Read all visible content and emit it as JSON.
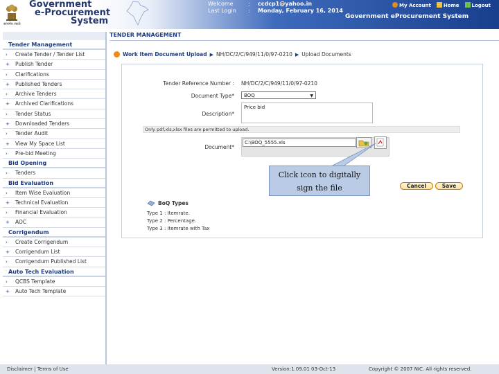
{
  "header": {
    "brand": [
      "Government",
      "e-Procurement",
      "System"
    ],
    "emblem_caption": "सत्यमेव जयते",
    "welcome_label": "Welcome",
    "welcome_value": "ccdcp1@yahoo.in",
    "lastlogin_label": "Last Login",
    "lastlogin_value": "Monday, February 16, 2014",
    "colon": ":",
    "links": {
      "account": "My Account",
      "home": "Home",
      "logout": "Logout"
    },
    "system_title": "Government eProcurement System"
  },
  "sidebar": {
    "sections": [
      {
        "title": "Tender Management",
        "items": [
          "Create Tender / Tender List",
          "Publish Tender",
          "Clarifications",
          "Published Tenders",
          "Archive Tenders",
          "Archived Clarifications",
          "Tender Status",
          "Downloaded Tenders",
          "Tender Audit",
          "View My Space List",
          "Pre-bid Meeting"
        ]
      },
      {
        "title": "Bid Opening",
        "items": [
          "Tenders"
        ]
      },
      {
        "title": "Bid Evaluation",
        "items": [
          "Item Wise Evaluation",
          "Technical Evaluation",
          "Financial Evaluation",
          "AOC"
        ]
      },
      {
        "title": "Corrigendum",
        "items": [
          "Create Corrigendum",
          "Corrigendum List",
          "Corrigendum Published List"
        ]
      },
      {
        "title": "Auto Tech Evaluation",
        "items": [
          "QCBS Template",
          "Auto Tech Template"
        ]
      }
    ]
  },
  "main": {
    "section_title": "TENDER MANAGEMENT",
    "breadcrumb": [
      "Work Item Document Upload",
      "NH/DC/2/C/949/11/0/97-0210",
      "Upload Documents"
    ],
    "form": {
      "ref_label": "Tender Reference Number :",
      "ref_value": "NH/DC/2/C/949/11/0/97-0210",
      "doctype_label": "Document Type*",
      "doctype_value": "BOQ",
      "desc_label": "Description*",
      "desc_value": "Price bid",
      "notice": "Only pdf,xls,xlsx files are permitted to upload.",
      "document_label": "Document*",
      "file_value": "C:\\BOQ_5555.xls"
    },
    "callout": [
      "Click icon to digitally",
      "sign the file"
    ],
    "buttons": {
      "cancel": "Cancel",
      "save": "Save"
    },
    "boq": {
      "title": "BoQ Types",
      "lines": [
        "Type 1 : Itemrate.",
        "Type 2 : Percentage.",
        "Type 3 : Itemrate with Tax"
      ]
    }
  },
  "footer": {
    "links": "Disclaimer  |  Terms of Use",
    "version": "Version:1.09.01 03-Oct-13",
    "copyright": "Copyright © 2007 NIC. All rights reserved."
  },
  "colors": {
    "brand_blue": "#1d3c80",
    "header_dark": "#183f8c",
    "callout": "#b9cbe5",
    "button_orange": "#fde2a0"
  }
}
